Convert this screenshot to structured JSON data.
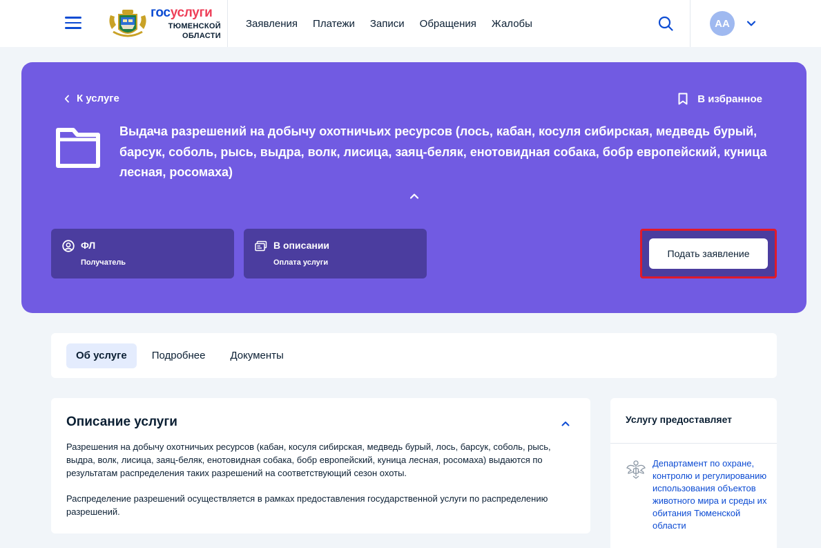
{
  "header": {
    "logo": {
      "word_gos": "гос",
      "word_uslugi": "услуги",
      "region_line1": "ТЮМЕНСКОЙ",
      "region_line2": "ОБЛАСТИ"
    },
    "nav": [
      "Заявления",
      "Платежи",
      "Записи",
      "Обращения",
      "Жалобы"
    ],
    "avatar_initials": "АА",
    "brand_color": "#0d4cd3"
  },
  "hero": {
    "back_label": "К услуге",
    "favorite_label": "В избранное",
    "title": "Выдача разрешений на добычу охотничьих ресурсов (лось, кабан, косуля сибирская, медведь бурый, барсук, соболь, рысь, выдра, волк, лисица, заяц-беляк, енотовидная собака, бобр европейский, куница лесная, росомаха)",
    "cards": [
      {
        "value": "ФЛ",
        "label": "Получатель",
        "icon": "user-circle-icon"
      },
      {
        "value": "В описании",
        "label": "Оплата услуги",
        "icon": "payment-icon"
      }
    ],
    "submit_label": "Подать заявление",
    "bg_color": "#715be2"
  },
  "tabs": [
    {
      "label": "Об услуге",
      "active": true
    },
    {
      "label": "Подробнее",
      "active": false
    },
    {
      "label": "Документы",
      "active": false
    }
  ],
  "description": {
    "title": "Описание услуги",
    "paragraphs": [
      "Разрешения на добычу охотничьих ресурсов (кабан, косуля сибирская, медведь бурый, лось, барсук, соболь, рысь, выдра, волк, лисица, заяц-беляк, енотовидная собака, бобр европейский, куница лесная, росомаха) выдаются по результатам распределения таких разрешений на соответствующий сезон охоты.",
      "Распределение разрешений осуществляется в рамках предоставления государственной услуги по распределению разрешений."
    ]
  },
  "provider": {
    "title": "Услугу предоставляет",
    "name": "Департамент по охране, контролю и регулированию использования объектов животного мира и среды их обитания Тюменской области"
  }
}
